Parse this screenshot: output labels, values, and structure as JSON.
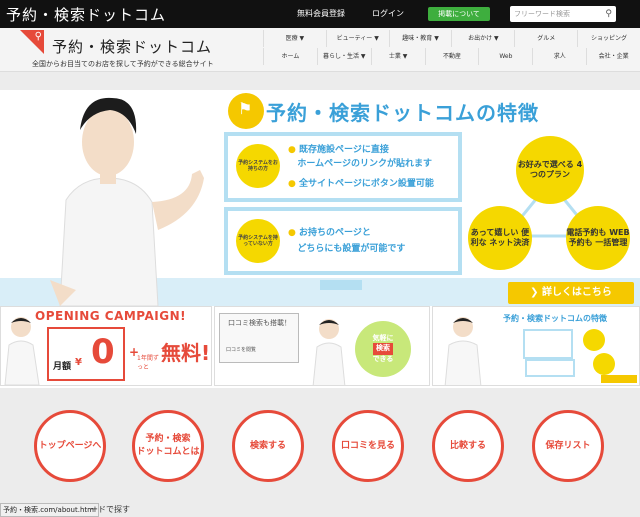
{
  "topbar": {
    "site_title": "予約・検索ドットコム",
    "register": "無料会員登録",
    "login": "ログイン",
    "publish": "掲載について",
    "search_placeholder": "フリーワード検索"
  },
  "header": {
    "logo_text": "予約・検索ドットコム",
    "tagline": "全国からお目当てのお店を探して予約ができる総合サイト"
  },
  "nav": {
    "row1": [
      "医療 ▼",
      "ビューティー ▼",
      "趣味・教育 ▼",
      "お出かけ ▼",
      "グルメ",
      "ショッピング"
    ],
    "row2": [
      "ホーム",
      "暮らし・生活 ▼",
      "士業 ▼",
      "不動産",
      "Web",
      "求人",
      "会社・企業"
    ]
  },
  "hero": {
    "feature_title": "予約・検索ドットコムの特徴",
    "box1_circle": "予約システムをお持ちの方",
    "box1_lines": [
      "既存施設ページに直接",
      "ホームページのリンクが貼れます",
      "全サイトページにボタン設置可能"
    ],
    "box2_circle": "予約システムを持っていない方",
    "box2_lines": [
      "お持ちのページと",
      "どちらにも設置が可能です"
    ],
    "plans": "お好みで選べる 4つのプラン",
    "plan_a": "あって嬉しい 便利な ネット決済",
    "plan_b": "電話予約も WEB予約も 一括管理",
    "more_button": "詳しくはこちら"
  },
  "banners": {
    "campaign_title": "OPENING CAMPAIGN!",
    "monthly": "月額",
    "zero": "0",
    "yen": "¥",
    "free": "無料!",
    "period": "1年間ずっと",
    "ban2_title": "口コミ検索も搭載！",
    "ban2_a": "気軽に",
    "ban2_b": "口コミを閲覧",
    "ban2_c": "検索",
    "ban2_d": "できる",
    "ban3_title": "予約・検索ドットコムの特徴"
  },
  "circles": [
    "トップページへ",
    "予約・検索\nドットコムとは",
    "検索する",
    "口コミを見る",
    "比較する",
    "保存リスト"
  ],
  "status": {
    "url": "予約・検索.com/about.html",
    "text": "ードで探す"
  },
  "colors": {
    "accent_red": "#e64a3a",
    "accent_yellow": "#f5c800",
    "accent_blue": "#3aa0d8"
  }
}
